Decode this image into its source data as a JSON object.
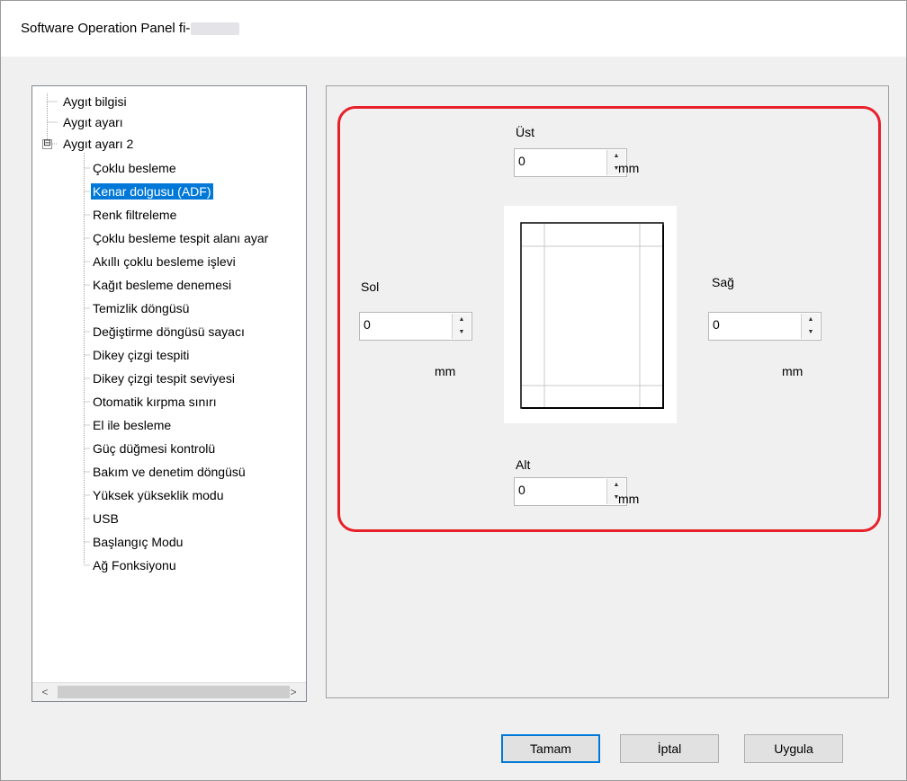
{
  "window": {
    "title": "Software Operation Panel fi-"
  },
  "tree": {
    "items": [
      {
        "label": "Aygıt bilgisi",
        "level": 0
      },
      {
        "label": "Aygıt ayarı",
        "level": 0
      },
      {
        "label": "Aygıt ayarı 2",
        "level": 0,
        "expanded": true
      },
      {
        "label": "Çoklu besleme",
        "level": 1
      },
      {
        "label": "Kenar dolgusu (ADF)",
        "level": 1,
        "selected": true
      },
      {
        "label": "Renk filtreleme",
        "level": 1
      },
      {
        "label": "Çoklu besleme tespit alanı ayar",
        "level": 1
      },
      {
        "label": "Akıllı çoklu besleme işlevi",
        "level": 1
      },
      {
        "label": "Kağıt besleme denemesi",
        "level": 1
      },
      {
        "label": "Temizlik döngüsü",
        "level": 1
      },
      {
        "label": "Değiştirme döngüsü sayacı",
        "level": 1
      },
      {
        "label": "Dikey çizgi tespiti",
        "level": 1
      },
      {
        "label": "Dikey çizgi tespit seviyesi",
        "level": 1
      },
      {
        "label": "Otomatik kırpma sınırı",
        "level": 1
      },
      {
        "label": "El ile besleme",
        "level": 1
      },
      {
        "label": "Güç düğmesi kontrolü",
        "level": 1
      },
      {
        "label": "Bakım ve denetim döngüsü",
        "level": 1
      },
      {
        "label": "Yüksek yükseklik modu",
        "level": 1
      },
      {
        "label": "USB",
        "level": 1
      },
      {
        "label": "Başlangıç Modu",
        "level": 1
      },
      {
        "label": "Ağ Fonksiyonu",
        "level": 1
      }
    ],
    "expander_symbol": "⊟",
    "scroll_left": "<",
    "scroll_right": ">"
  },
  "margins": {
    "top": {
      "label": "Üst",
      "value": "0",
      "unit": "mm"
    },
    "left": {
      "label": "Sol",
      "value": "0",
      "unit": "mm"
    },
    "right": {
      "label": "Sağ",
      "value": "0",
      "unit": "mm"
    },
    "bottom": {
      "label": "Alt",
      "value": "0",
      "unit": "mm"
    }
  },
  "spin_arrows": {
    "up": "▲",
    "down": "▼"
  },
  "buttons": {
    "ok": "Tamam",
    "cancel": "İptal",
    "apply": "Uygula"
  },
  "colors": {
    "highlight": "#e8202a",
    "selection": "#0078d7"
  }
}
